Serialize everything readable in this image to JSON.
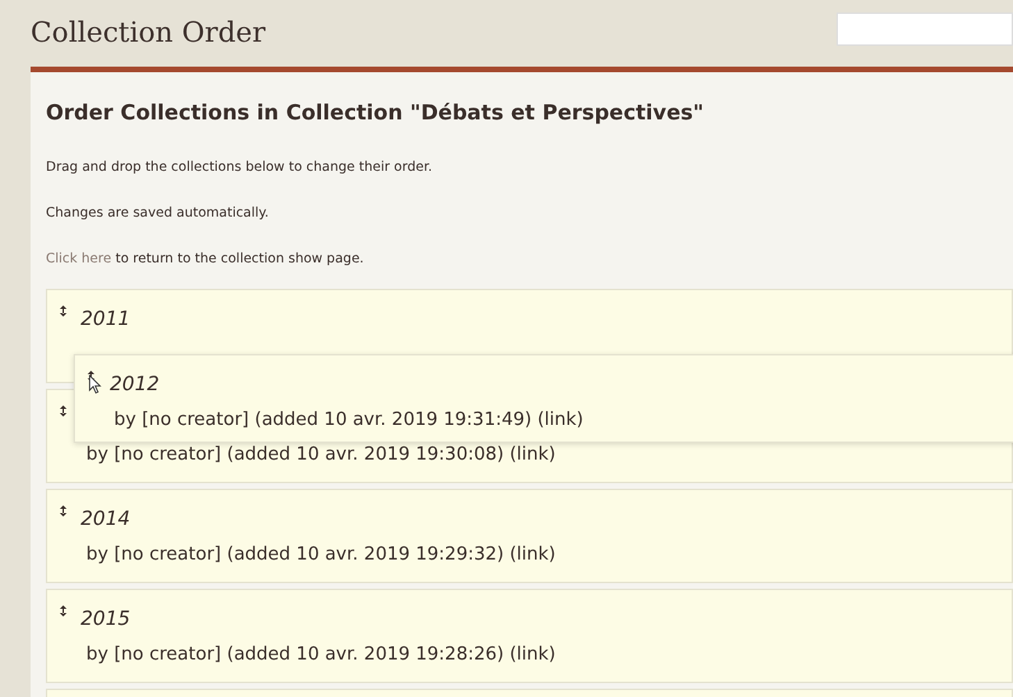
{
  "page_title": "Collection Order",
  "heading": "Order Collections in Collection \"Débats et Perspectives\"",
  "instructions": [
    "Drag and drop the collections below to change their order.",
    "Changes are saved automatically."
  ],
  "return_note": {
    "link": "Click here",
    "text": " to return to the collection show page."
  },
  "collections": [
    {
      "kind": "item",
      "title": "2011"
    },
    {
      "kind": "item",
      "byline": "by [no creator] (added 10 avr. 2019 19:30:08) (link)"
    },
    {
      "kind": "item",
      "title": "2014",
      "byline": "by [no creator] (added 10 avr. 2019 19:29:32) (link)"
    },
    {
      "kind": "item",
      "title": "2015",
      "byline": "by [no creator] (added 10 avr. 2019 19:28:26) (link)"
    },
    {
      "kind": "item"
    }
  ],
  "dragged_item": {
    "title": "2012",
    "byline": "by [no creator] (added 10 avr. 2019 19:31:49) (link)"
  }
}
